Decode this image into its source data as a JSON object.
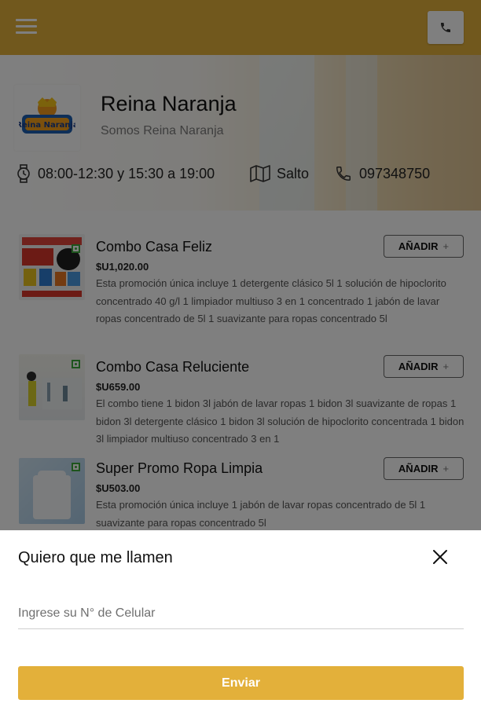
{
  "header": {
    "menu_icon": "hamburger-icon",
    "call_icon": "phone-icon",
    "accent_color": "#e3b03a"
  },
  "store": {
    "name": "Reina Naranja",
    "tagline": "Somos Reina Naranja",
    "logo_alt": "Reina Naranja",
    "hours": "08:00-12:30 y 15:30 a 19:00",
    "city": "Salto",
    "phone": "097348750"
  },
  "products": [
    {
      "title": "Combo Casa Feliz",
      "price": "$U1,020.00",
      "description": "Esta promoción única incluye 1 detergente clásico 5l 1 solución de hipoclorito concentrado 40 g/l 1 limpiador multiuso 3 en 1 concentrado 1 jabón de lavar ropas concentrado de 5l 1 suavizante para ropas concentrado 5l",
      "add_label": "AÑADIR",
      "add_symbol": "+"
    },
    {
      "title": "Combo Casa Reluciente",
      "price": "$U659.00",
      "description": "El combo tiene 1 bidon 3l jabón de lavar ropas 1 bidon 3l suavizante de ropas 1 bidon 3l detergente clásico 1 bidon 3l solución de hipoclorito concentrada 1 bidon 3l limpiador multiuso concentrado 3 en 1",
      "add_label": "AÑADIR",
      "add_symbol": "+"
    },
    {
      "title": "Super Promo Ropa Limpia",
      "price": "$U503.00",
      "description": "Esta promoción única incluye 1 jabón de lavar ropas concentrado de 5l 1 suavizante para ropas concentrado 5l",
      "add_label": "AÑADIR",
      "add_symbol": "+"
    }
  ],
  "callback_sheet": {
    "title": "Quiero que me llamen",
    "close_icon": "close-icon",
    "phone_placeholder": "Ingrese su N° de Celular",
    "phone_value": "",
    "submit_label": "Enviar"
  }
}
